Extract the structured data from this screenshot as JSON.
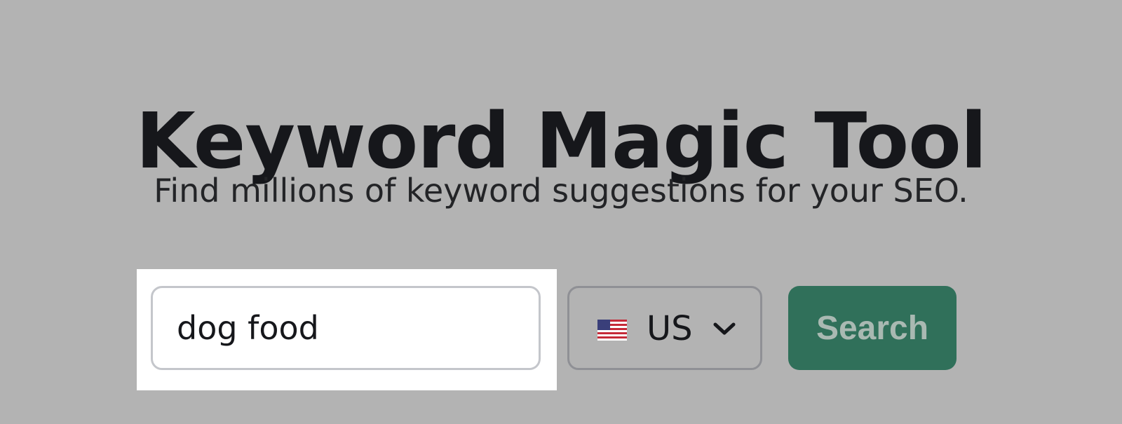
{
  "header": {
    "title": "Keyword Magic Tool",
    "subtitle": "Find millions of keyword suggestions for your SEO."
  },
  "search": {
    "value": "dog food",
    "placeholder": ""
  },
  "country": {
    "selected": "US",
    "flag_icon": "us-flag-icon",
    "dropdown_icon": "chevron-down-icon"
  },
  "search_button": {
    "label": "Search",
    "color": "#30705a"
  },
  "colors": {
    "background": "#b3b3b3",
    "highlight": "#ffffff",
    "text": "#16171b"
  }
}
